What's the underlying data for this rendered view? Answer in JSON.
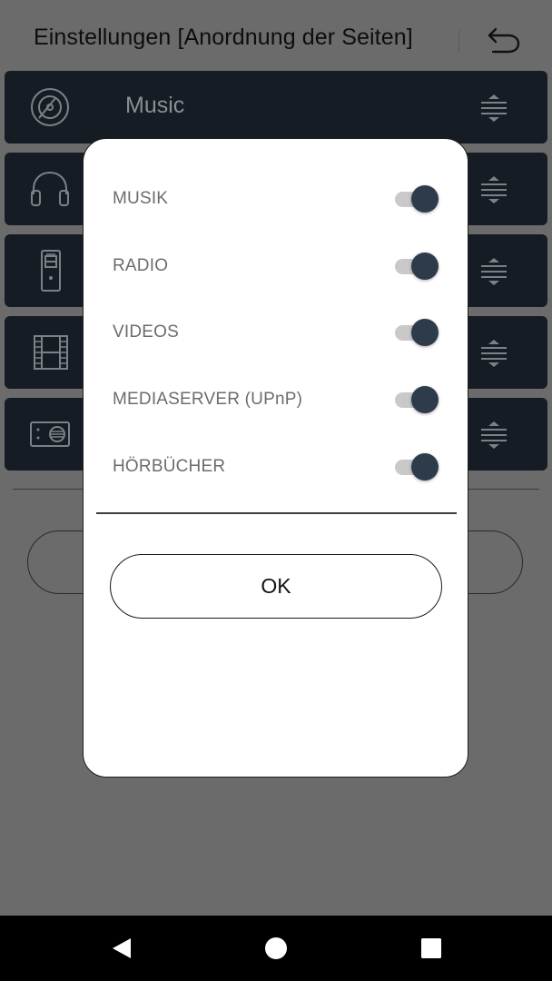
{
  "header": {
    "title": "Einstellungen [Anordnung der Seiten]",
    "back_icon": "undo-arrow-icon"
  },
  "page_list": {
    "items": [
      {
        "label": "Music",
        "icon": "disc-icon"
      },
      {
        "label": "",
        "icon": "headphones-icon"
      },
      {
        "label": "",
        "icon": "media-player-icon"
      },
      {
        "label": "",
        "icon": "film-icon"
      },
      {
        "label": "",
        "icon": "radio-icon"
      }
    ]
  },
  "dialog": {
    "toggles": [
      {
        "label": "MUSIK",
        "on": true
      },
      {
        "label": "RADIO",
        "on": true
      },
      {
        "label": "VIDEOS",
        "on": true
      },
      {
        "label": "MEDIASERVER (UPnP)",
        "on": true
      },
      {
        "label": "HÖRBÜCHER",
        "on": true
      }
    ],
    "ok_label": "OK"
  },
  "colors": {
    "background_dimmed": "#6b6b6b",
    "row_background": "#161c24",
    "toggle_knob": "#2e3b4a",
    "toggle_track": "#c9c9c9",
    "dialog_background": "#ffffff"
  },
  "nav_bar": {
    "buttons": [
      "back-triangle-icon",
      "home-circle-icon",
      "recents-square-icon"
    ]
  }
}
